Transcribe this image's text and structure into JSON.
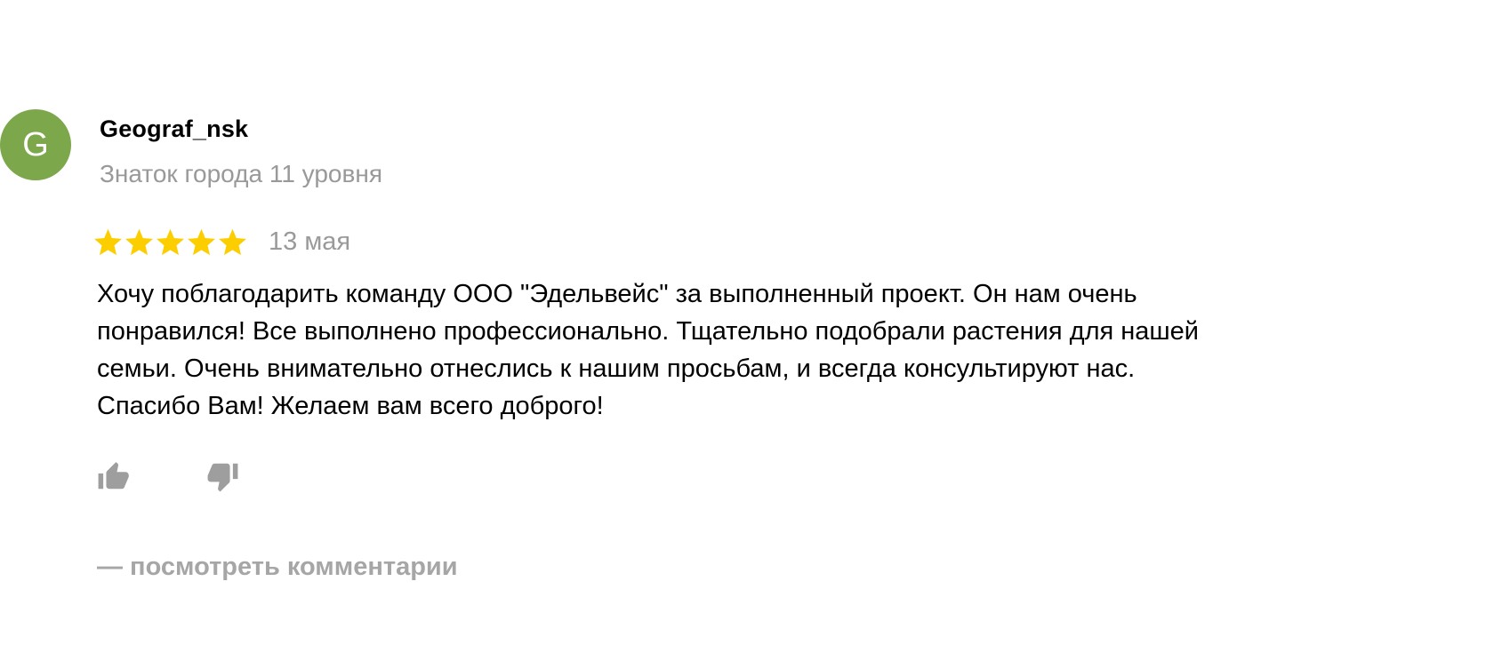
{
  "author": {
    "initial": "G",
    "name": "Geograf_nsk",
    "level": "Знаток города 11 уровня",
    "avatar_color": "#7ca74a"
  },
  "review": {
    "rating": 5,
    "rating_max": 5,
    "star_color": "#fcce00",
    "date": "13 мая",
    "text": "Хочу поблагодарить команду ООО \"Эдельвейс\" за выполненный проект. Он нам очень\nпонравился! Все выполнено профессионально. Тщательно подобрали растения для нашей\nсемьи. Очень внимательно отнеслись к нашим просьбам, и всегда консультируют нас.\nСпасибо Вам! Желаем вам всего доброго!"
  },
  "reactions": {
    "like_icon": "thumbs-up-icon",
    "dislike_icon": "thumbs-down-icon",
    "icon_color": "#9e9e9e"
  },
  "comments_link": "— посмотреть комментарии"
}
